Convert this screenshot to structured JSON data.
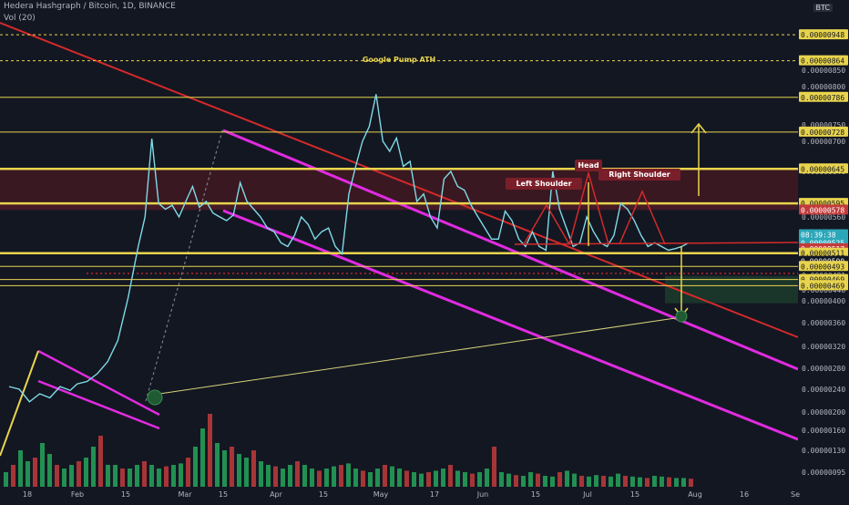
{
  "header": {
    "title": "Hedera Hashgraph / Bitcoin, 1D, BINANCE",
    "volume_label": "Vol (20)",
    "currency": "BTC"
  },
  "colors": {
    "background": "#131722",
    "price_line": "#7fdbe6",
    "channel_red": "#d42a2a",
    "channel_magenta": "#e02be0",
    "level_yellow": "#e8d44d",
    "vol_up": "#26a65b",
    "vol_down": "#c23b3b"
  },
  "chart_data": {
    "type": "line",
    "title": "Hedera Hashgraph / Bitcoin, 1D, BINANCE",
    "xlabel": "",
    "ylabel": "",
    "x_ticks": [
      "18",
      "Feb",
      "15",
      "Mar",
      "15",
      "Apr",
      "15",
      "May",
      "17",
      "Jun",
      "15",
      "Jul",
      "15",
      "Aug",
      "16",
      "Se"
    ],
    "y_ticks": [
      "0.00000095",
      "0.00000130",
      "0.00000160",
      "0.00000200",
      "0.00000240",
      "0.00000280",
      "0.00000320",
      "0.00000360",
      "0.00000400",
      "0.00000440",
      "0.00000481",
      "0.00000560",
      "0.00000600",
      "0.00000640",
      "0.00000700",
      "0.00000750",
      "0.00000800",
      "0.00000850",
      "0.00000900"
    ],
    "ylim": [
      9e-07,
      9.5e-06
    ],
    "price_labels": [
      {
        "text": "0.00000948",
        "value": 9.48e-06,
        "style": "yellow"
      },
      {
        "text": "0.00000864",
        "value": 8.64e-06,
        "style": "yellow"
      },
      {
        "text": "0.00000786",
        "value": 7.86e-06,
        "style": "yellow"
      },
      {
        "text": "0.00000728",
        "value": 7.28e-06,
        "style": "yellow"
      },
      {
        "text": "0.00000645",
        "value": 6.45e-06,
        "style": "yellow"
      },
      {
        "text": "0.00000595",
        "value": 5.95e-06,
        "style": "yellow"
      },
      {
        "text": "0.00000578",
        "value": 5.78e-06,
        "style": "red"
      },
      {
        "text": "0.00000525",
        "value": 5.25e-06,
        "style": "current"
      },
      {
        "text": "08:39:38",
        "value": 5.36e-06,
        "style": "timer"
      },
      {
        "text": "0.00000517",
        "value": 5.17e-06,
        "style": "red"
      },
      {
        "text": "0.00000511",
        "value": 5.11e-06,
        "style": "yellow"
      },
      {
        "text": "0.00000500",
        "value": 5e-06,
        "style": "plain"
      },
      {
        "text": "0.00000493",
        "value": 4.93e-06,
        "style": "yellow"
      },
      {
        "text": "0.00000469",
        "value": 4.69e-06,
        "style": "yellow"
      },
      {
        "text": "0.00000469",
        "value": 4.52e-06,
        "style": "yellow"
      }
    ],
    "price_series": {
      "name": "HBAR/BTC",
      "x": [
        0,
        3,
        6,
        9,
        12,
        15,
        18,
        20,
        23,
        26,
        29,
        32,
        35,
        38,
        40,
        42,
        44,
        46,
        48,
        50,
        52,
        54,
        56,
        58,
        60,
        62,
        64,
        66,
        68,
        70,
        72,
        74,
        76,
        78,
        80,
        82,
        84,
        86,
        88,
        90,
        92,
        94,
        96,
        98,
        100,
        102,
        104,
        106,
        108,
        110,
        112,
        114,
        116,
        118,
        120,
        122,
        124,
        126,
        128,
        130,
        132,
        134,
        136,
        138,
        140,
        142,
        144,
        146,
        148,
        150,
        152,
        154,
        156,
        158,
        160,
        162,
        164,
        166,
        168,
        170,
        172,
        174,
        176,
        178,
        180,
        182,
        184,
        186,
        188,
        190,
        192,
        194,
        196,
        198,
        200
      ],
      "values": [
        2.45e-06,
        2.4e-06,
        2.18e-06,
        2.32e-06,
        2.25e-06,
        2.45e-06,
        2.38e-06,
        2.5e-06,
        2.55e-06,
        2.7e-06,
        2.92e-06,
        3.3e-06,
        4.1e-06,
        5.2e-06,
        5.6e-06,
        7.08e-06,
        5.95e-06,
        5.8e-06,
        5.9e-06,
        5.6e-06,
        6e-06,
        6.2e-06,
        5.85e-06,
        6e-06,
        5.7e-06,
        5.6e-06,
        5.55e-06,
        5.65e-06,
        6.25e-06,
        6e-06,
        5.8e-06,
        5.6e-06,
        5.45e-06,
        5.4e-06,
        5.25e-06,
        5.2e-06,
        5.35e-06,
        5.6e-06,
        5.5e-06,
        5.3e-06,
        5.4e-06,
        5.45e-06,
        5.2e-06,
        5.1e-06,
        6.1e-06,
        6.5e-06,
        7e-06,
        7.45e-06,
        7.9e-06,
        7e-06,
        6.8e-06,
        7.1e-06,
        6.5e-06,
        6.6e-06,
        6e-06,
        6.1e-06,
        5.6e-06,
        5.45e-06,
        6.3e-06,
        6.4e-06,
        6.2e-06,
        6.15e-06,
        5.9e-06,
        5.6e-06,
        5.45e-06,
        5.3e-06,
        5.3e-06,
        5.75e-06,
        5.55e-06,
        5.3e-06,
        5.2e-06,
        5.4e-06,
        5.2e-06,
        5.15e-06,
        6.4e-06,
        5.8e-06,
        5.45e-06,
        5.2e-06,
        5.25e-06,
        5.6e-06,
        5.4e-06,
        5.25e-06,
        5.2e-06,
        5.35e-06,
        5.95e-06,
        5.8e-06,
        5.55e-06,
        5.35e-06,
        5.2e-06,
        5.25e-06,
        5.2e-06,
        5.15e-06,
        5.17e-06,
        5.2e-06,
        5.25e-06
      ]
    },
    "annotations": [
      "Google Pump ATH",
      "Left Shoulder",
      "Head",
      "Right Shoulder"
    ],
    "volume": {
      "name": "Vol (20)",
      "values": [
        0.2,
        0.3,
        0.5,
        0.35,
        0.4,
        0.6,
        0.45,
        0.3,
        0.25,
        0.3,
        0.35,
        0.4,
        0.55,
        0.7,
        0.3,
        0.3,
        0.25,
        0.25,
        0.3,
        0.35,
        0.3,
        0.25,
        0.28,
        0.3,
        0.32,
        0.4,
        0.55,
        0.8,
        1.0,
        0.6,
        0.5,
        0.55,
        0.45,
        0.4,
        0.5,
        0.35,
        0.3,
        0.28,
        0.25,
        0.3,
        0.35,
        0.3,
        0.25,
        0.22,
        0.25,
        0.28,
        0.3,
        0.32,
        0.25,
        0.22,
        0.2,
        0.25,
        0.3,
        0.28,
        0.25,
        0.22,
        0.2,
        0.18,
        0.2,
        0.22,
        0.25,
        0.3,
        0.22,
        0.2,
        0.18,
        0.2,
        0.25,
        0.55,
        0.2,
        0.18,
        0.16,
        0.15,
        0.2,
        0.18,
        0.15,
        0.14,
        0.2,
        0.22,
        0.18,
        0.15,
        0.14,
        0.16,
        0.15,
        0.14,
        0.18,
        0.15,
        0.14,
        0.13,
        0.12,
        0.15,
        0.14,
        0.13,
        0.12,
        0.12,
        0.11
      ]
    },
    "grid": false,
    "legend": "none"
  }
}
